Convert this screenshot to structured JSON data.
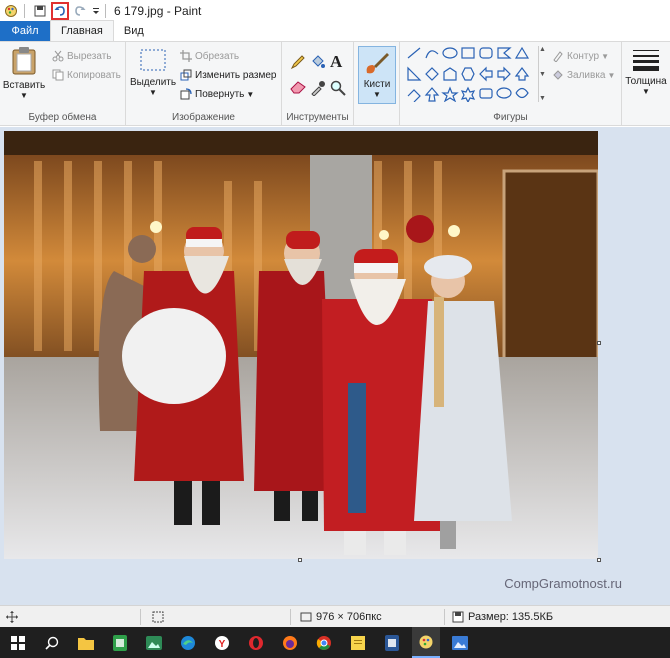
{
  "window": {
    "title": "6 179.jpg - Paint"
  },
  "quick_access": {
    "save_icon": "save-icon",
    "undo_icon": "undo-icon",
    "redo_icon": "redo-icon",
    "customize_icon": "chevron-down-icon"
  },
  "tabs": {
    "file": "Файл",
    "home": "Главная",
    "view": "Вид"
  },
  "ribbon": {
    "clipboard": {
      "label": "Буфер обмена",
      "paste": "Вставить",
      "cut": "Вырезать",
      "copy": "Копировать"
    },
    "image": {
      "label": "Изображение",
      "select": "Выделить",
      "crop": "Обрезать",
      "resize": "Изменить размер",
      "rotate": "Повернуть"
    },
    "tools": {
      "label": "Инструменты"
    },
    "brushes": {
      "label": "Кисти"
    },
    "shapes": {
      "label": "Фигуры",
      "outline": "Контур",
      "fill": "Заливка"
    },
    "size": {
      "label": "Толщина"
    }
  },
  "canvas": {
    "watermark": "CompGramotnost.ru"
  },
  "status": {
    "dimensions": "976 × 706пкс",
    "size": "Размер: 135.5КБ"
  },
  "colors": {
    "accent": "#1e6fc7",
    "highlight": "#e03030",
    "canvas_bg": "#d8e2ef"
  }
}
